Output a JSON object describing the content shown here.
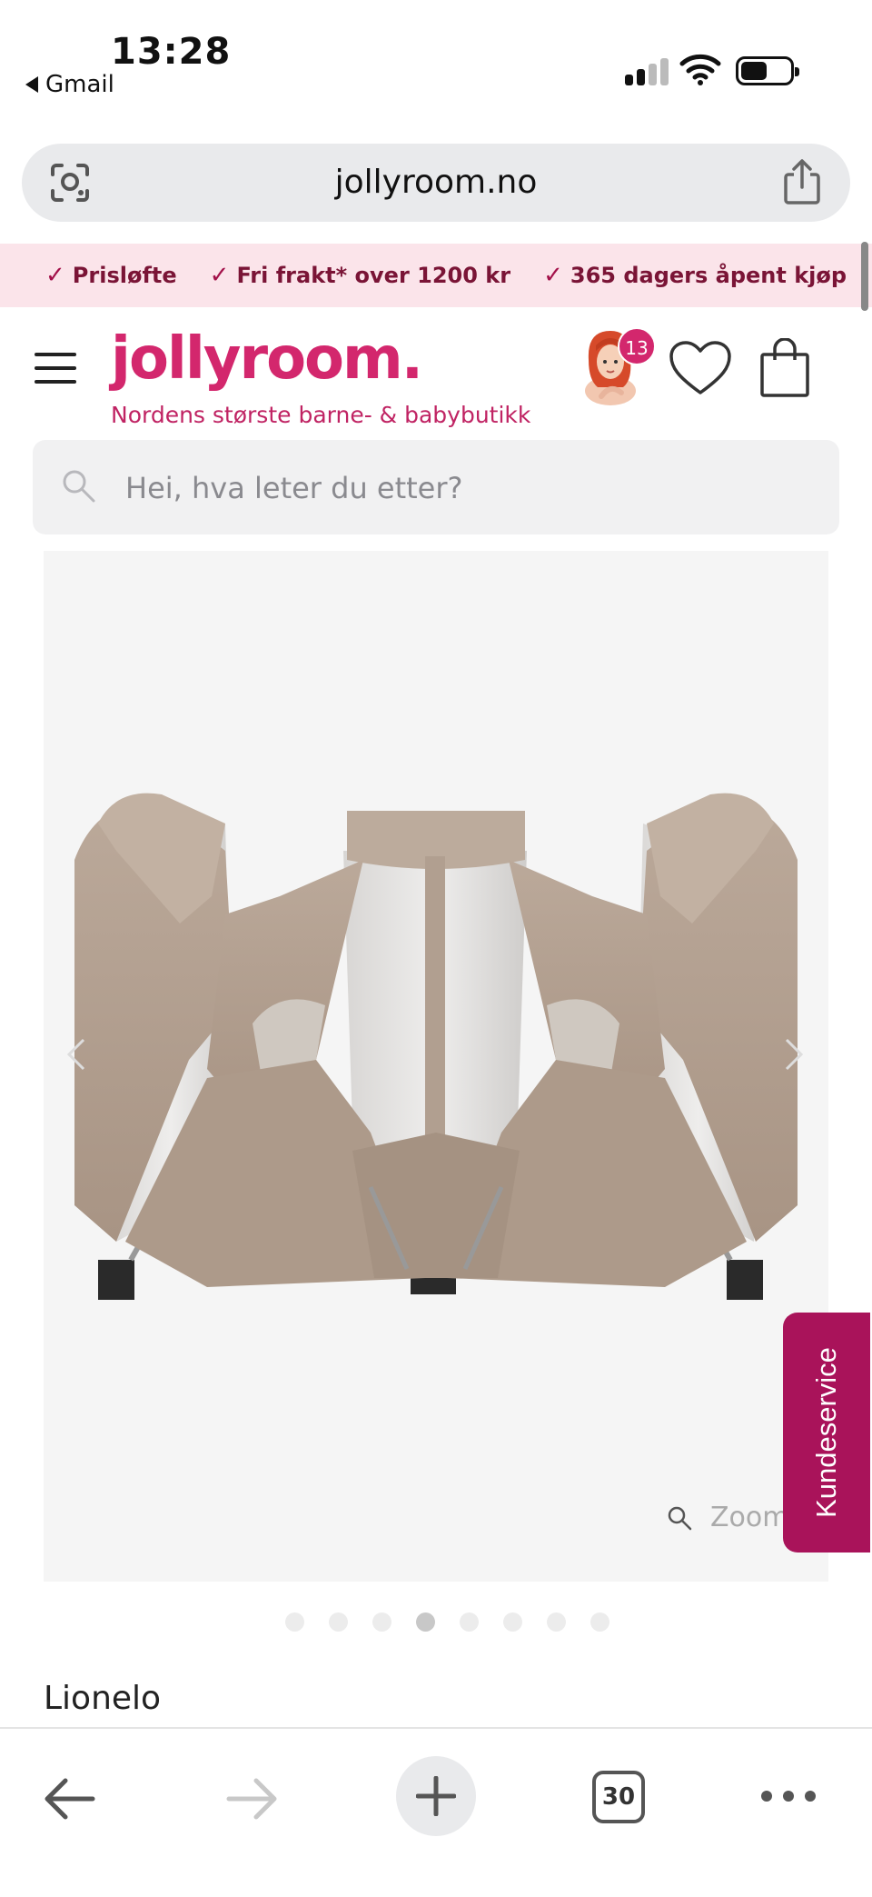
{
  "status_bar": {
    "time": "13:28",
    "back_app": "Gmail",
    "icons": [
      "signal-icon",
      "wifi-icon",
      "battery-icon"
    ]
  },
  "browser": {
    "url": "jollyroom.no",
    "left_icon": "visual-search-icon",
    "right_icon": "share-icon"
  },
  "promo": {
    "items": [
      "Prisløfte",
      "Fri frakt* over 1200 kr",
      "365 dagers åpent kjøp"
    ],
    "check_color": "#a3114a",
    "background": "#fbe4ea"
  },
  "header": {
    "logo": "jollyroom.",
    "tagline": "Nordens største barne- & babybutikk",
    "avatar_badge": "13",
    "brand_color": "#d3276d"
  },
  "search": {
    "placeholder": "Hei, hva leter du etter?"
  },
  "gallery": {
    "zoom_label": "Zoom",
    "dot_count": 8,
    "active_dot": 4
  },
  "side_tab": {
    "label": "Kundeservice",
    "color": "#a9135a"
  },
  "product": {
    "brand": "Lionelo"
  },
  "toolbar": {
    "tab_count": "30",
    "icons": [
      "back-arrow-icon",
      "forward-arrow-icon",
      "plus-icon",
      "tabs-icon",
      "more-icon"
    ]
  }
}
